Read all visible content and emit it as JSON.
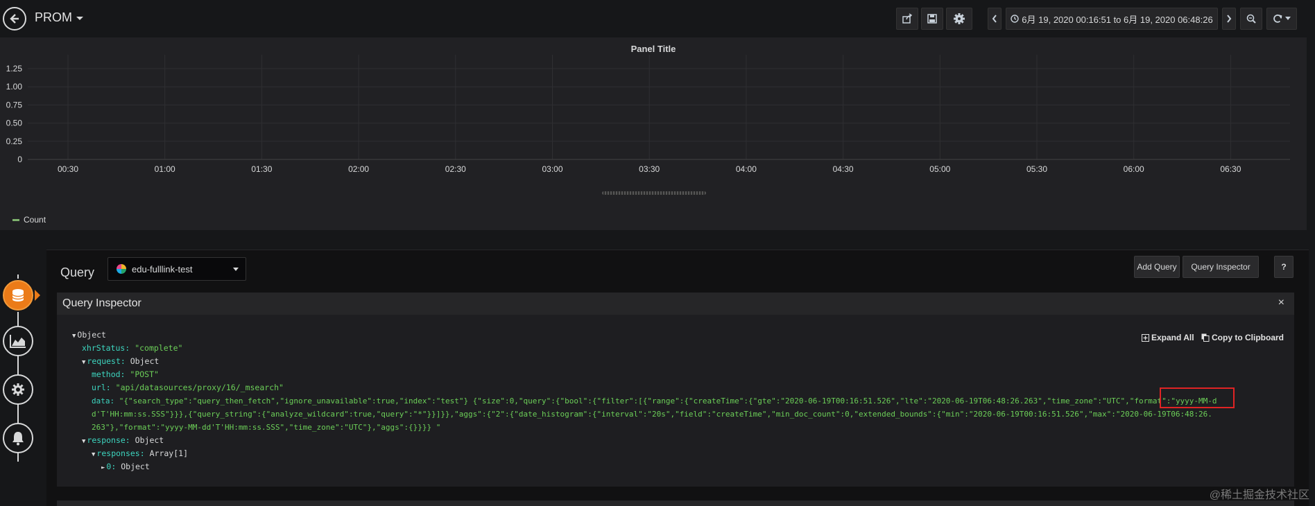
{
  "navbar": {
    "dashboard_title": "PROM",
    "time_range": "6月 19, 2020 00:16:51 to 6月 19, 2020 06:48:26"
  },
  "panel": {
    "title": "Panel Title",
    "legend_label": "Count"
  },
  "chart_data": {
    "type": "line",
    "title": "Panel Title",
    "x_ticks": [
      "00:30",
      "01:00",
      "01:30",
      "02:00",
      "02:30",
      "03:00",
      "03:30",
      "04:00",
      "04:30",
      "05:00",
      "05:30",
      "06:00",
      "06:30"
    ],
    "y_ticks": [
      "0",
      "0.25",
      "0.50",
      "0.75",
      "1.00",
      "1.25"
    ],
    "ylim": [
      0,
      1.25
    ],
    "grid": true,
    "legend": "bottom-left",
    "series": [
      {
        "name": "Count",
        "values": []
      }
    ],
    "series_color": "#7eb26d"
  },
  "editor": {
    "query_label": "Query",
    "datasource": "edu-fulllink-test",
    "add_query_label": "Add Query",
    "query_inspector_label": "Query Inspector",
    "help_label": "?"
  },
  "inspector": {
    "title": "Query Inspector",
    "close": "×",
    "expand_all": "Expand All",
    "copy_label": "Copy to Clipboard",
    "tree": {
      "root": "Object",
      "xhr_key": "xhrStatus:",
      "xhr_val": "\"complete\"",
      "request_key": "request:",
      "request_val": "Object",
      "method_key": "method:",
      "method_val": "\"POST\"",
      "url_key": "url:",
      "url_val": "\"api/datasources/proxy/16/_msearch\"",
      "data_key": "data:",
      "data_line1": "\"{\"search_type\":\"query_then_fetch\",\"ignore_unavailable\":true,\"index\":\"test\"} {\"size\":0,\"query\":{\"bool\":{\"filter\":[{\"range\":{\"createTime\":{\"gte\":\"2020-06-19T00:16:51.526\",\"lte\":\"2020-06-19T06:48:26.263\",\"time_zone\":\"UTC\",\"format\":\"yyyy-MM-d",
      "data_line2": "d'T'HH:mm:ss.SSS\"}}},{\"query_string\":{\"analyze_wildcard\":true,\"query\":\"*\"}}]}},\"aggs\":{\"2\":{\"date_histogram\":{\"interval\":\"20s\",\"field\":\"createTime\",\"min_doc_count\":0,\"extended_bounds\":{\"min\":\"2020-06-19T00:16:51.526\",\"max\":\"2020-06-19T06:48:26.",
      "data_line3": "263\"},\"format\":\"yyyy-MM-dd'T'HH:mm:ss.SSS\",\"time_zone\":\"UTC\"},\"aggs\":{}}}} \"",
      "response_key": "response:",
      "response_val": "Object",
      "responses_key": "responses:",
      "responses_val": "Array[1]",
      "item_key": "0:",
      "item_val": "Object"
    }
  },
  "watermark": "@稀土掘金技术社区"
}
